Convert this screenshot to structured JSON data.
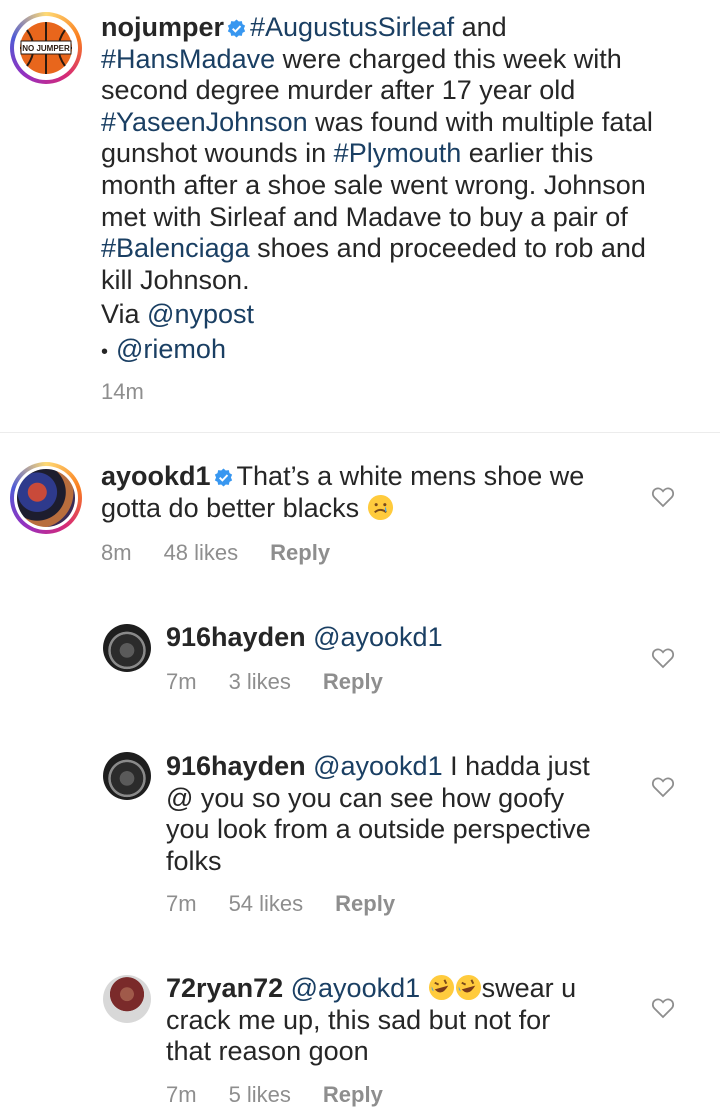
{
  "post": {
    "username": "nojumper",
    "avatar_text": "NO JUMPER",
    "line1_after_user": "#AugustusSirleaf",
    "line1_and": " and",
    "line2_tag": "#HansMadave",
    "line2_rest": " were charged this week with",
    "line3": "second degree murder after 17 year old",
    "line4_tag": "#YaseenJohnson",
    "line4_rest": " was found with multiple fatal",
    "line5_a": "gunshot wounds in ",
    "line5_tag": "#Plymouth",
    "line5_b": " earlier this",
    "line6": "month after a shoe sale went wrong. Johnson",
    "line7": "met with Sirleaf and Madave to buy a pair of",
    "line8_tag": "#Balenciaga",
    "line8_rest": " shoes and proceeded to rob and",
    "line9": "kill Johnson.",
    "via_label": "Via ",
    "via_mention": "@nypost",
    "credit_bullet": "•",
    "credit_mention": "@riemoh",
    "time": "14m"
  },
  "comments": [
    {
      "username": "ayookd1",
      "line1": "That’s a white mens shoe we",
      "line2": "gotta do better blacks",
      "emoji": "crying-face",
      "time": "8m",
      "likes": "48 likes",
      "reply": "Reply"
    },
    {
      "username": "916hayden",
      "mention": "@ayookd1",
      "time": "7m",
      "likes": "3 likes",
      "reply": "Reply"
    },
    {
      "username": "916hayden",
      "mention": "@ayookd1",
      "line1_rest": " I hadda just",
      "line2": "@ you so you can see how goofy",
      "line3": "you look from a outside perspective",
      "line4": "folks",
      "time": "7m",
      "likes": "54 likes",
      "reply": "Reply"
    },
    {
      "username": "72ryan72",
      "mention": "@ayookd1",
      "emoji": "rolling-on-floor-laughing",
      "line1_rest": "swear u",
      "line2": "crack me up, this sad but not for",
      "line3": "that reason goon",
      "time": "7m",
      "likes": "5 likes",
      "reply": "Reply"
    }
  ],
  "colors": {
    "text": "#262626",
    "hashtag": "#1a3f63",
    "meta": "#8e8e8e",
    "verified": "#3897f0"
  }
}
